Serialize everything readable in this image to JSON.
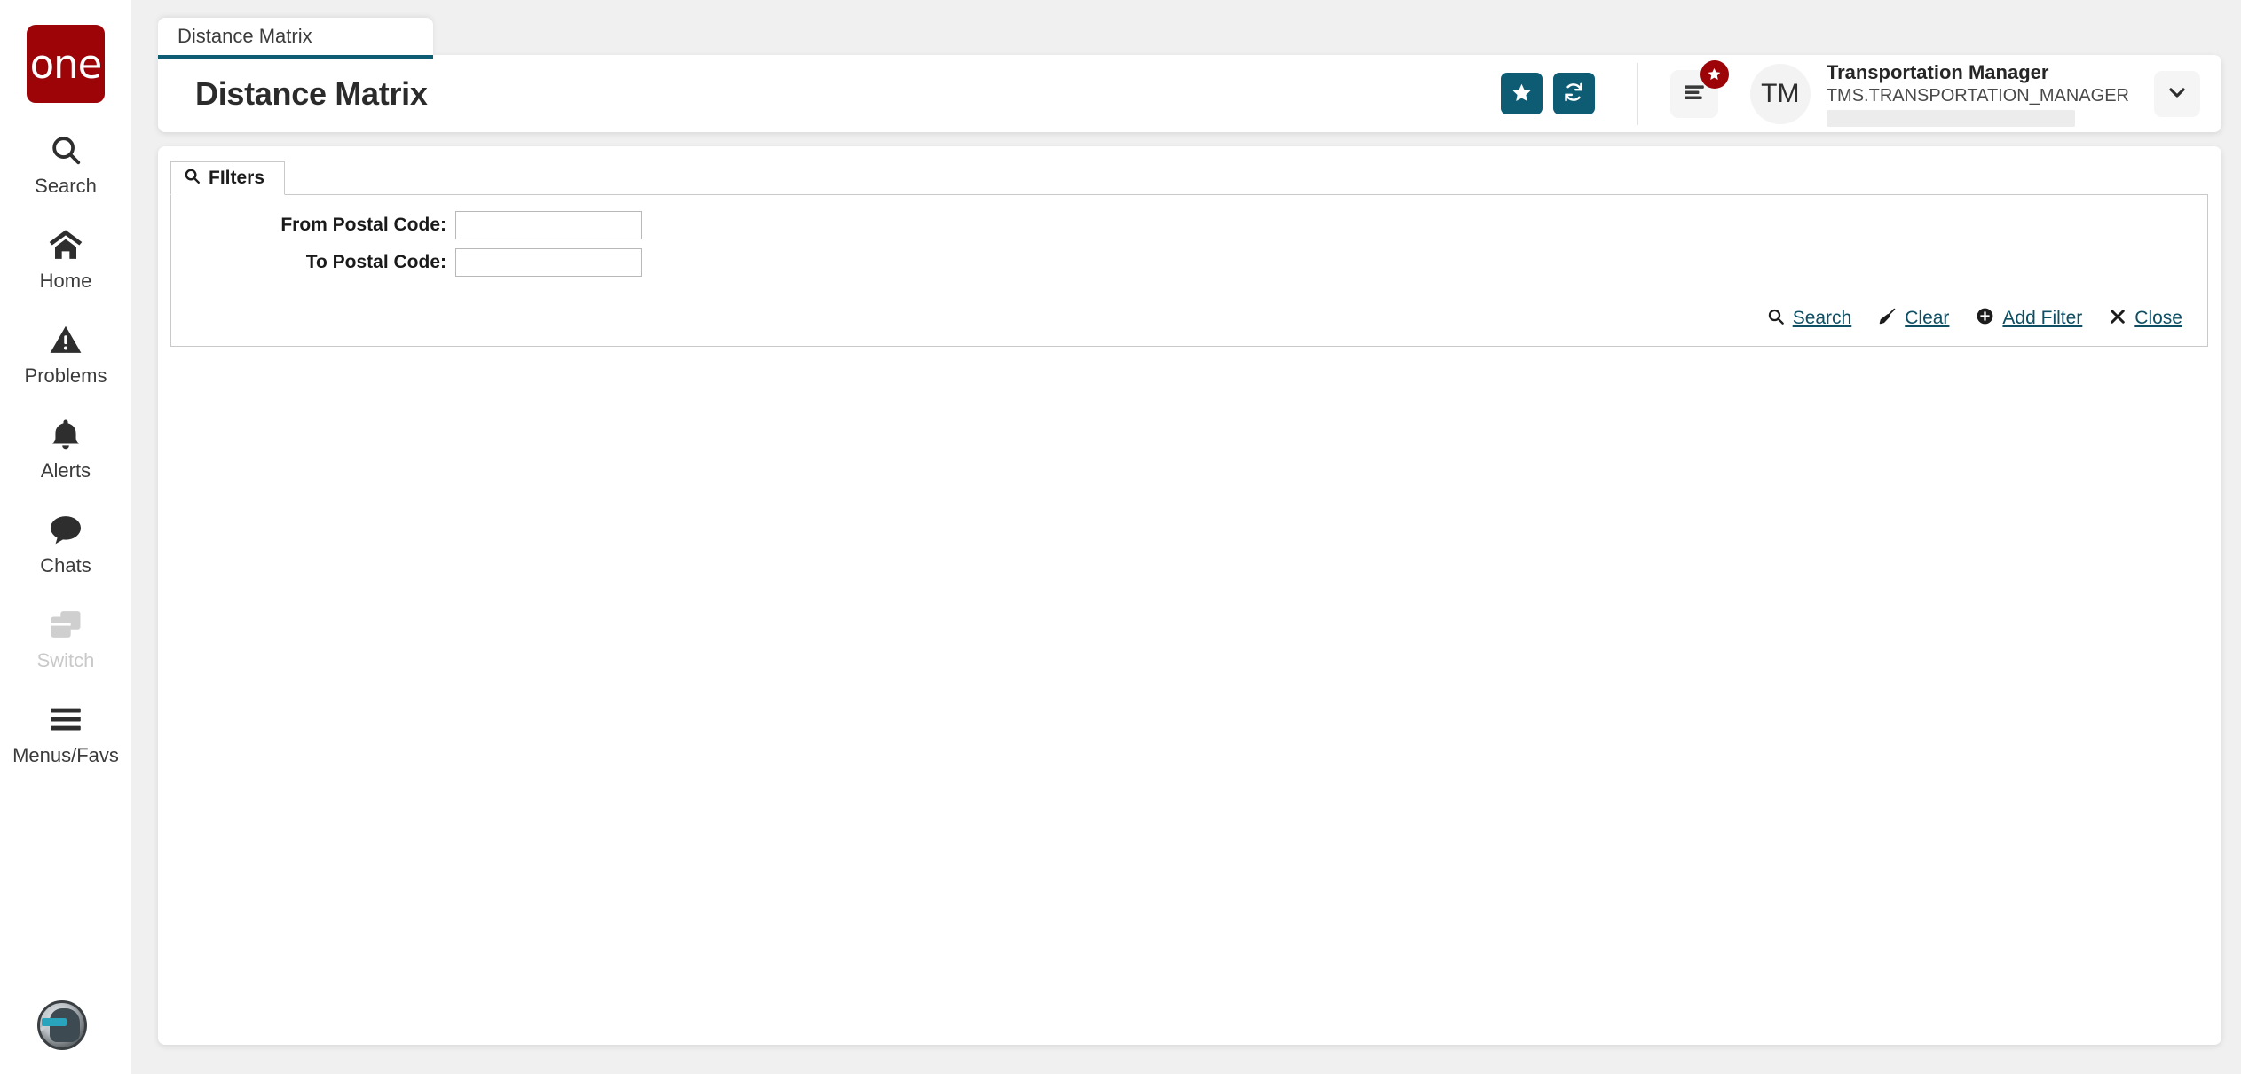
{
  "brand": {
    "logo_text": "one",
    "logo_color": "#9c0408"
  },
  "theme": {
    "accent": "#0d5c73",
    "link": "#0f4f63",
    "badge": "#9c0408"
  },
  "sidebar": {
    "items": [
      {
        "label": "Search",
        "icon": "search-icon",
        "disabled": false
      },
      {
        "label": "Home",
        "icon": "home-icon",
        "disabled": false
      },
      {
        "label": "Problems",
        "icon": "warning-triangle-icon",
        "disabled": false
      },
      {
        "label": "Alerts",
        "icon": "bell-icon",
        "disabled": false
      },
      {
        "label": "Chats",
        "icon": "chat-bubble-icon",
        "disabled": false
      },
      {
        "label": "Switch",
        "icon": "switch-windows-icon",
        "disabled": true
      },
      {
        "label": "Menus/Favs",
        "icon": "hamburger-icon",
        "disabled": false
      }
    ],
    "assistant_avatar": "ai-assistant-avatar"
  },
  "tabs": [
    {
      "label": "Distance Matrix",
      "active": true
    }
  ],
  "header": {
    "title": "Distance Matrix",
    "favorite_button": "star-icon",
    "refresh_button": "refresh-icon",
    "menus_favs_button": "menu-lines-icon",
    "menus_favs_badge": "star-badge-icon",
    "avatar_initials": "TM",
    "user_name": "Transportation Manager",
    "user_role": "TMS.TRANSPORTATION_MANAGER",
    "user_redacted": "",
    "dropdown_button": "chevron-down-icon"
  },
  "filters": {
    "tab_label": "FIlters",
    "tab_icon": "search-icon",
    "fields": [
      {
        "label": "From Postal Code:",
        "value": "",
        "placeholder": "",
        "name": "from-postal-code"
      },
      {
        "label": "To Postal Code:",
        "value": "",
        "placeholder": "",
        "name": "to-postal-code"
      }
    ],
    "actions": [
      {
        "label": "Search",
        "icon": "search-icon"
      },
      {
        "label": "Clear",
        "icon": "broom-icon"
      },
      {
        "label": "Add Filter",
        "icon": "plus-circle-icon"
      },
      {
        "label": "Close",
        "icon": "close-x-icon"
      }
    ]
  }
}
